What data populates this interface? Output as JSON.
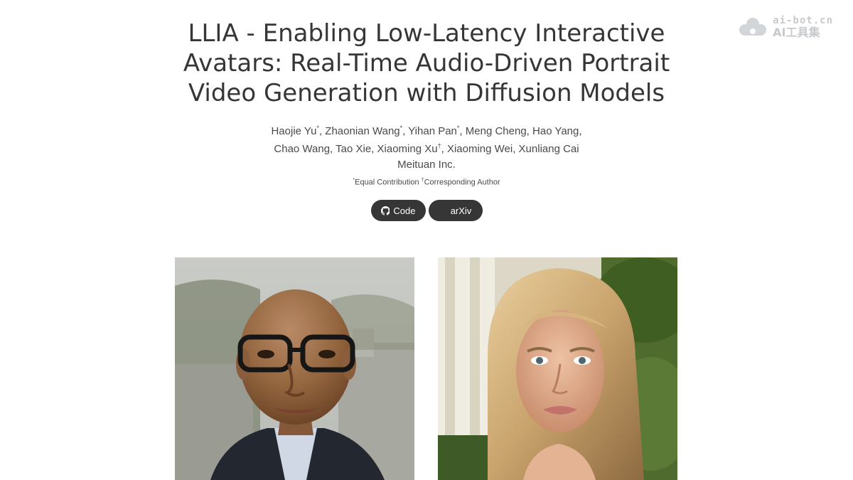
{
  "watermark": {
    "domain": "ai-bot.cn",
    "name": "AI工具集"
  },
  "paper": {
    "title_lines": [
      "LLIA - Enabling Low-Latency Interactive",
      "Avatars: Real-Time Audio-Driven Portrait",
      "Video Generation with Diffusion Models"
    ],
    "authors": [
      {
        "name": "Haojie Yu",
        "mark": "*",
        "sep": ", "
      },
      {
        "name": "Zhaonian Wang",
        "mark": "*",
        "sep": ", "
      },
      {
        "name": "Yihan Pan",
        "mark": "*",
        "sep": ", "
      },
      {
        "name": "Meng Cheng",
        "mark": "",
        "sep": ", "
      },
      {
        "name": "Hao Yang",
        "mark": "",
        "sep": ","
      },
      {
        "name": "Chao Wang",
        "mark": "",
        "sep": ", "
      },
      {
        "name": "Tao Xie",
        "mark": "",
        "sep": ", "
      },
      {
        "name": "Xiaoming Xu",
        "mark": "†",
        "sep": ", "
      },
      {
        "name": "Xiaoming Wei",
        "mark": "",
        "sep": ", "
      },
      {
        "name": "Xunliang Cai",
        "mark": "",
        "sep": ""
      }
    ],
    "affiliation": "Meituan Inc.",
    "notes": {
      "equal_mark": "*",
      "equal_label": "Equal Contribution",
      "corr_mark": "†",
      "corr_label": "Corresponding Author"
    }
  },
  "links": {
    "code_label": "Code",
    "arxiv_label": "arXiv"
  },
  "colors": {
    "button_bg": "#363636",
    "title": "#363636"
  }
}
